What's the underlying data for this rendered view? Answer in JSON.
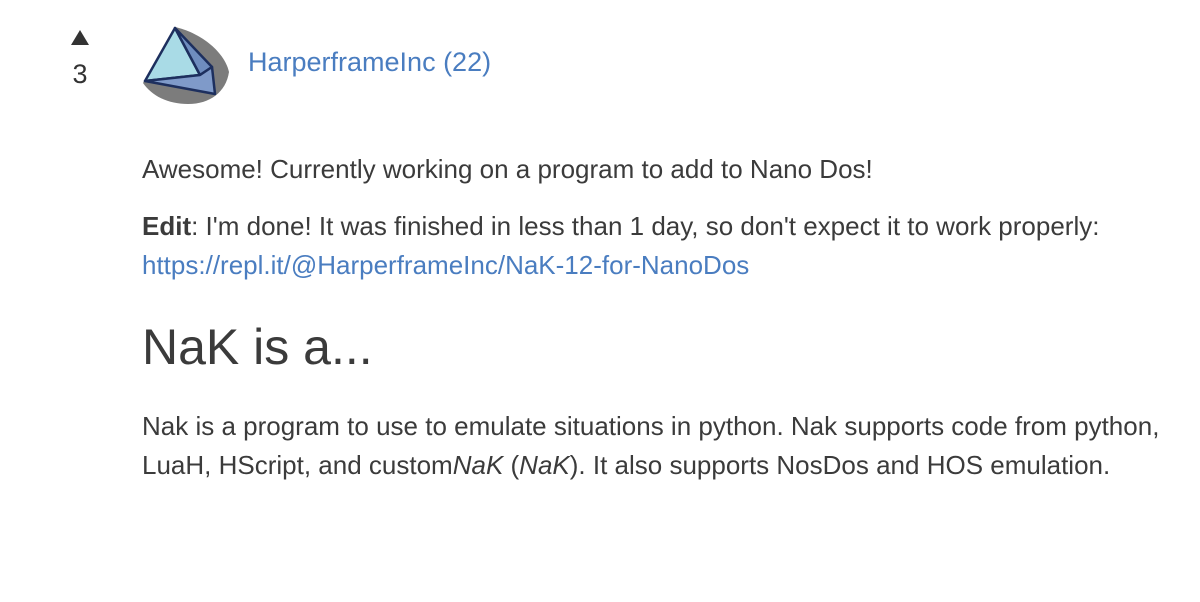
{
  "vote": {
    "count": "3",
    "icon": "upvote-arrow-icon"
  },
  "author": {
    "username": "HarperframeInc (22)",
    "avatar_colors": {
      "shadow": "#7c7c7c",
      "light": "#a9dbe6",
      "mid": "#7f9ac9",
      "outline": "#1d2f5e"
    }
  },
  "post": {
    "paragraph1": "Awesome! Currently working on a program to add to Nano Dos!",
    "edit_label": "Edit",
    "edit_text": ": I'm done! It was finished in less than 1 day, so don't expect it to work properly: ",
    "link": "https://repl.it/@HarperframeInc/NaK-12-for-NanoDos",
    "heading": "NaK is a...",
    "paragraph3_part1": "Nak is a program to use to emulate situations in python. Nak supports code from python, LuaH, HScript, and custom",
    "paragraph3_em1": "NaK",
    "paragraph3_part2": " (",
    "paragraph3_em2": "NaK",
    "paragraph3_part3": "). It also supports NosDos and HOS emulation."
  },
  "colors": {
    "text": "#3b3b3b",
    "link": "#4a7dc0",
    "background": "#ffffff"
  }
}
